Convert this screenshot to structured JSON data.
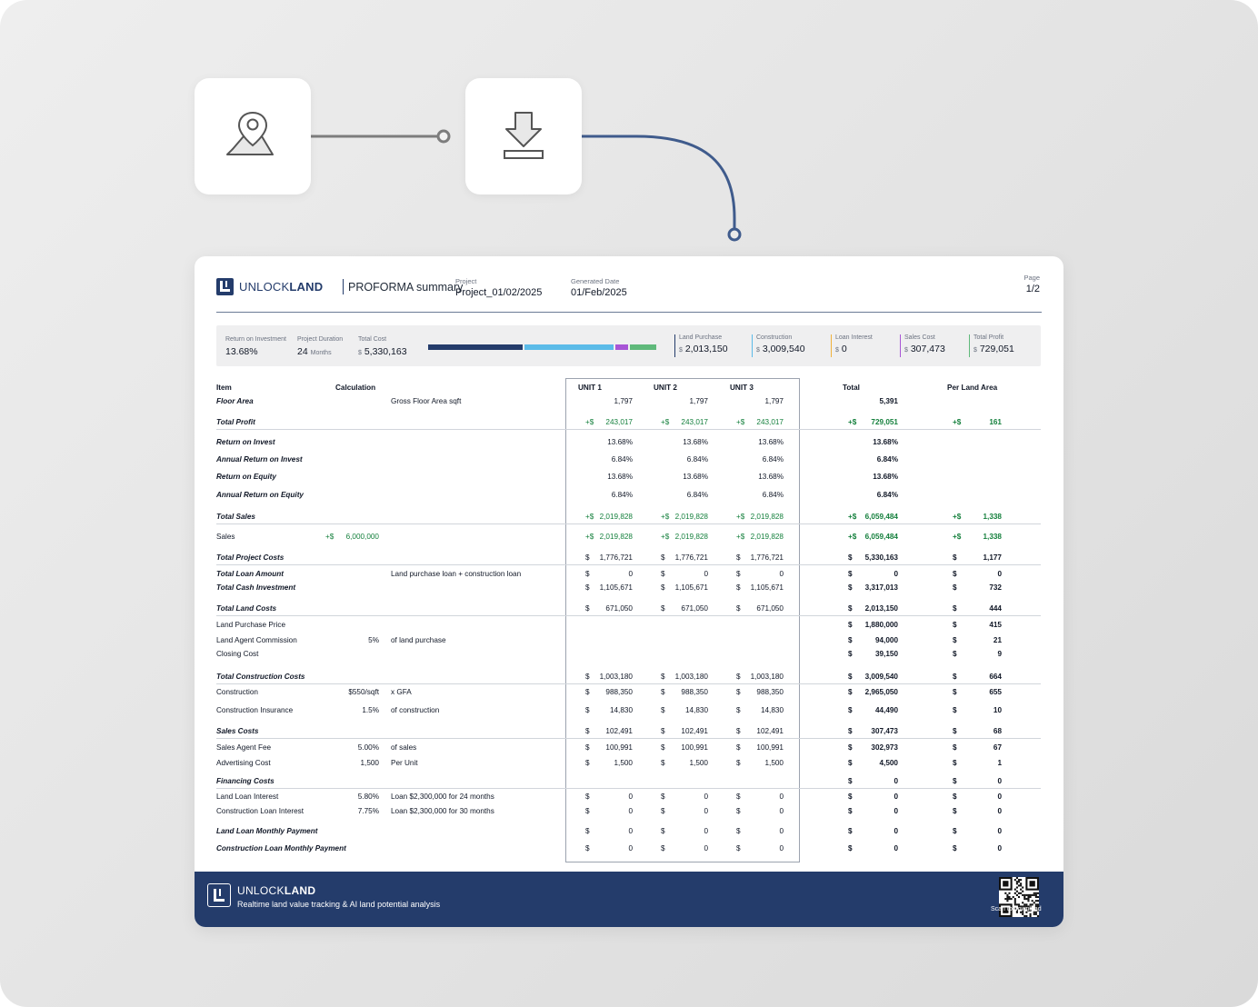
{
  "header": {
    "brand_light": "UNLOCK",
    "brand_bold": "LAND",
    "title": "PROFORMA summary",
    "project_label": "Project",
    "project_value": "Project_01/02/2025",
    "date_label": "Generated Date",
    "date_value": "01/Feb/2025",
    "page_label": "Page",
    "page_value": "1/2"
  },
  "summary": {
    "roi_label": "Return on Investment",
    "roi_value": "13.68%",
    "duration_label": "Project Duration",
    "duration_value": "24",
    "duration_unit": "Months",
    "cost_label": "Total Cost",
    "cost_currency": "$",
    "cost_value": "5,330,163",
    "kpis": [
      {
        "label": "Land Purchase",
        "currency": "$",
        "value": "2,013,150",
        "color": "#243c6b"
      },
      {
        "label": "Construction",
        "currency": "$",
        "value": "3,009,540",
        "color": "#5bbbe8"
      },
      {
        "label": "Loan Interest",
        "currency": "$",
        "value": "0",
        "color": "#f0b23a"
      },
      {
        "label": "Sales Cost",
        "currency": "$",
        "value": "307,473",
        "color": "#a855d6"
      },
      {
        "label": "Total Profit",
        "currency": "$",
        "value": "729,051",
        "color": "#5fb97b"
      }
    ],
    "bar_colors": [
      "#243c6b",
      "#5bbbe8",
      "#a855d6",
      "#5fb97b"
    ]
  },
  "table": {
    "headers": {
      "item": "Item",
      "calc": "Calculation",
      "u1": "UNIT 1",
      "u2": "UNIT 2",
      "u3": "UNIT 3",
      "total": "Total",
      "per": "Per Land Area"
    },
    "rows": [
      {
        "label": "Floor Area",
        "section": true,
        "desc": "Gross Floor Area sqft",
        "u": [
          [
            "",
            "1,797"
          ],
          [
            "",
            "1,797"
          ],
          [
            "",
            "1,797"
          ]
        ],
        "total": [
          "",
          "5,391"
        ],
        "per": [
          "",
          ""
        ]
      },
      {
        "label": "Total Profit",
        "section": true,
        "line": true,
        "green": true,
        "u": [
          [
            "+$",
            "243,017"
          ],
          [
            "+$",
            "243,017"
          ],
          [
            "+$",
            "243,017"
          ]
        ],
        "total": [
          "+$",
          "729,051"
        ],
        "per": [
          "+$",
          "161"
        ]
      },
      {
        "label": "Return on Invest",
        "section": true,
        "u": [
          [
            "",
            "13.68%"
          ],
          [
            "",
            "13.68%"
          ],
          [
            "",
            "13.68%"
          ]
        ],
        "total": [
          "",
          "13.68%"
        ],
        "per": [
          "",
          ""
        ]
      },
      {
        "label": "Annual Return on Invest",
        "section": true,
        "u": [
          [
            "",
            "6.84%"
          ],
          [
            "",
            "6.84%"
          ],
          [
            "",
            "6.84%"
          ]
        ],
        "total": [
          "",
          "6.84%"
        ],
        "per": [
          "",
          ""
        ]
      },
      {
        "label": "Return on Equity",
        "section": true,
        "u": [
          [
            "",
            "13.68%"
          ],
          [
            "",
            "13.68%"
          ],
          [
            "",
            "13.68%"
          ]
        ],
        "total": [
          "",
          "13.68%"
        ],
        "per": [
          "",
          ""
        ]
      },
      {
        "label": "Annual Return on Equity",
        "section": true,
        "u": [
          [
            "",
            "6.84%"
          ],
          [
            "",
            "6.84%"
          ],
          [
            "",
            "6.84%"
          ]
        ],
        "total": [
          "",
          "6.84%"
        ],
        "per": [
          "",
          ""
        ]
      },
      {
        "label": "Total Sales",
        "section": true,
        "line": true,
        "green": true,
        "u": [
          [
            "+$",
            "2,019,828"
          ],
          [
            "+$",
            "2,019,828"
          ],
          [
            "+$",
            "2,019,828"
          ]
        ],
        "total": [
          "+$",
          "6,059,484"
        ],
        "per": [
          "+$",
          "1,338"
        ]
      },
      {
        "label": "Sales",
        "calc_prefix": "+$",
        "calc": "6,000,000",
        "green": true,
        "u": [
          [
            "+$",
            "2,019,828"
          ],
          [
            "+$",
            "2,019,828"
          ],
          [
            "+$",
            "2,019,828"
          ]
        ],
        "total": [
          "+$",
          "6,059,484"
        ],
        "per": [
          "+$",
          "1,338"
        ]
      },
      {
        "label": "Total Project Costs",
        "section": true,
        "line": true,
        "u": [
          [
            "$",
            "1,776,721"
          ],
          [
            "$",
            "1,776,721"
          ],
          [
            "$",
            "1,776,721"
          ]
        ],
        "total": [
          "$",
          "5,330,163"
        ],
        "per": [
          "$",
          "1,177"
        ]
      },
      {
        "label": "Total Loan Amount",
        "section": true,
        "desc": "Land purchase loan + construction loan",
        "u": [
          [
            "$",
            "0"
          ],
          [
            "$",
            "0"
          ],
          [
            "$",
            "0"
          ]
        ],
        "total": [
          "$",
          "0"
        ],
        "per": [
          "$",
          "0"
        ]
      },
      {
        "label": "Total Cash Investment",
        "section": true,
        "u": [
          [
            "$",
            "1,105,671"
          ],
          [
            "$",
            "1,105,671"
          ],
          [
            "$",
            "1,105,671"
          ]
        ],
        "total": [
          "$",
          "3,317,013"
        ],
        "per": [
          "$",
          "732"
        ]
      },
      {
        "label": "Total Land Costs",
        "section": true,
        "line": true,
        "u": [
          [
            "$",
            "671,050"
          ],
          [
            "$",
            "671,050"
          ],
          [
            "$",
            "671,050"
          ]
        ],
        "total": [
          "$",
          "2,013,150"
        ],
        "per": [
          "$",
          "444"
        ]
      },
      {
        "label": "Land Purchase Price",
        "total": [
          "$",
          "1,880,000"
        ],
        "per": [
          "$",
          "415"
        ]
      },
      {
        "label": "Land Agent Commission",
        "calc": "5%",
        "desc": "of land purchase",
        "total": [
          "$",
          "94,000"
        ],
        "per": [
          "$",
          "21"
        ]
      },
      {
        "label": "Closing Cost",
        "total": [
          "$",
          "39,150"
        ],
        "per": [
          "$",
          "9"
        ]
      },
      {
        "label": "Total Construction Costs",
        "section": true,
        "line": true,
        "u": [
          [
            "$",
            "1,003,180"
          ],
          [
            "$",
            "1,003,180"
          ],
          [
            "$",
            "1,003,180"
          ]
        ],
        "total": [
          "$",
          "3,009,540"
        ],
        "per": [
          "$",
          "664"
        ]
      },
      {
        "label": "Construction",
        "calc": "$550/sqft",
        "desc": "x GFA",
        "u": [
          [
            "$",
            "988,350"
          ],
          [
            "$",
            "988,350"
          ],
          [
            "$",
            "988,350"
          ]
        ],
        "total": [
          "$",
          "2,965,050"
        ],
        "per": [
          "$",
          "655"
        ]
      },
      {
        "label": "Construction Insurance",
        "calc": "1.5%",
        "desc": "of construction",
        "u": [
          [
            "$",
            "14,830"
          ],
          [
            "$",
            "14,830"
          ],
          [
            "$",
            "14,830"
          ]
        ],
        "total": [
          "$",
          "44,490"
        ],
        "per": [
          "$",
          "10"
        ]
      },
      {
        "label": "Sales Costs",
        "section": true,
        "line": true,
        "u": [
          [
            "$",
            "102,491"
          ],
          [
            "$",
            "102,491"
          ],
          [
            "$",
            "102,491"
          ]
        ],
        "total": [
          "$",
          "307,473"
        ],
        "per": [
          "$",
          "68"
        ]
      },
      {
        "label": "Sales Agent Fee",
        "calc": "5.00%",
        "desc": "of sales",
        "u": [
          [
            "$",
            "100,991"
          ],
          [
            "$",
            "100,991"
          ],
          [
            "$",
            "100,991"
          ]
        ],
        "total": [
          "$",
          "302,973"
        ],
        "per": [
          "$",
          "67"
        ]
      },
      {
        "label": "Advertising Cost",
        "calc": "1,500",
        "desc": "Per Unit",
        "u": [
          [
            "$",
            "1,500"
          ],
          [
            "$",
            "1,500"
          ],
          [
            "$",
            "1,500"
          ]
        ],
        "total": [
          "$",
          "4,500"
        ],
        "per": [
          "$",
          "1"
        ]
      },
      {
        "label": "Financing Costs",
        "section": true,
        "line": true,
        "total": [
          "$",
          "0"
        ],
        "per": [
          "$",
          "0"
        ]
      },
      {
        "label": "Land Loan Interest",
        "calc": "5.80%",
        "desc": "Loan $2,300,000 for 24 months",
        "u": [
          [
            "$",
            "0"
          ],
          [
            "$",
            "0"
          ],
          [
            "$",
            "0"
          ]
        ],
        "total": [
          "$",
          "0"
        ],
        "per": [
          "$",
          "0"
        ]
      },
      {
        "label": "Construction Loan Interest",
        "calc": "7.75%",
        "desc": "Loan $2,300,000 for 30 months",
        "u": [
          [
            "$",
            "0"
          ],
          [
            "$",
            "0"
          ],
          [
            "$",
            "0"
          ]
        ],
        "total": [
          "$",
          "0"
        ],
        "per": [
          "$",
          "0"
        ]
      },
      {
        "label": "Land Loan Monthly Payment",
        "section": true,
        "u": [
          [
            "$",
            "0"
          ],
          [
            "$",
            "0"
          ],
          [
            "$",
            "0"
          ]
        ],
        "total": [
          "$",
          "0"
        ],
        "per": [
          "$",
          "0"
        ]
      },
      {
        "label": "Construction Loan Monthly Payment",
        "section": true,
        "u": [
          [
            "$",
            "0"
          ],
          [
            "$",
            "0"
          ],
          [
            "$",
            "0"
          ]
        ],
        "total": [
          "$",
          "0"
        ],
        "per": [
          "$",
          "0"
        ]
      }
    ]
  },
  "footer": {
    "brand_light": "UNLOCK",
    "brand_bold": "LAND",
    "tagline": "Realtime land value tracking & AI land potential analysis",
    "qr_caption": "Scan to download"
  },
  "icons": {
    "step1": "map-pin-icon",
    "step2": "download-icon"
  }
}
